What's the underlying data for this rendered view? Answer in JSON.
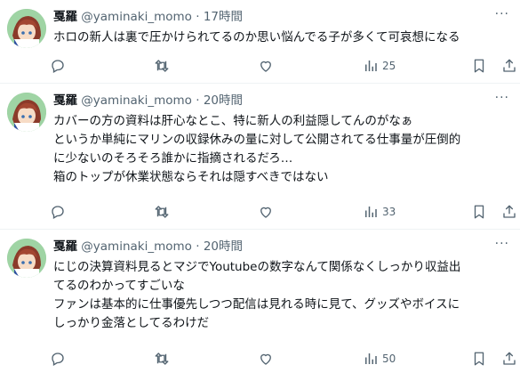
{
  "tweets": [
    {
      "name": "戛羅",
      "handle": "@yaminaki_momo",
      "time": "17時間",
      "lines": [
        "ホロの新人は裏で圧かけられてるのか思い悩んでる子が多くて可哀想になる"
      ],
      "views": "25"
    },
    {
      "name": "戛羅",
      "handle": "@yaminaki_momo",
      "time": "20時間",
      "lines": [
        "カバーの方の資料は肝心なとこ、特に新人の利益隠してんのがなぁ",
        "というか単純にマリンの収録休みの量に対して公開されてる仕事量が圧倒的",
        "に少ないのそろそろ誰かに指摘されるだろ…",
        "箱のトップが休業状態ならそれは隠すべきではない"
      ],
      "views": "33"
    },
    {
      "name": "戛羅",
      "handle": "@yaminaki_momo",
      "time": "20時間",
      "lines": [
        "にじの決算資料見るとマジでYoutubeの数字なんて関係なくしっかり収益出",
        "てるのわかってすごいな",
        "ファンは基本的に仕事優先しつつ配信は見れる時に見て、グッズやボイスに",
        "しっかり金落としてるわけだ"
      ],
      "views": "50"
    }
  ],
  "ui": {
    "dot": "·",
    "more": "···"
  },
  "icons": [
    "reply-icon",
    "retweet-icon",
    "like-icon",
    "views-icon",
    "bookmark-icon",
    "share-icon"
  ],
  "colors": {
    "text": "#0f1419",
    "secondary": "#536471",
    "divider": "#eff3f4"
  }
}
